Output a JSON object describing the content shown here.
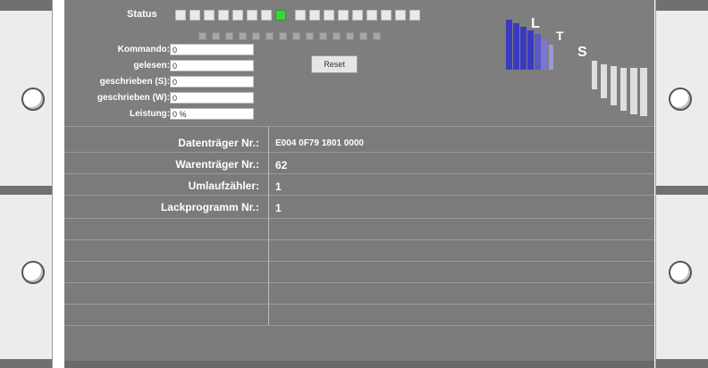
{
  "status": {
    "label": "Status",
    "leds": [
      false,
      false,
      false,
      false,
      false,
      false,
      false,
      true,
      false,
      false,
      false,
      false,
      false,
      false,
      false,
      false,
      false
    ]
  },
  "fields": [
    {
      "label": "Kommando:",
      "value": "0"
    },
    {
      "label": "gelesen:",
      "value": "0"
    },
    {
      "label": "geschrieben (S):",
      "value": "0"
    },
    {
      "label": "geschrieben (W):",
      "value": "0"
    },
    {
      "label": "Leistung:",
      "value": "0 %"
    }
  ],
  "reset_button": "Reset",
  "meter": {
    "letter_l": "L",
    "letter_t": "T",
    "letter_s": "S",
    "accent": "#3a3ac0"
  },
  "rows": [
    {
      "label": "Datenträger Nr.:",
      "value": "E004 0F79 1801 0000"
    },
    {
      "label": "Warenträger Nr.:",
      "value": "62"
    },
    {
      "label": "Umlaufzähler:",
      "value": "1"
    },
    {
      "label": "Lackprogramm Nr.:",
      "value": "1"
    }
  ]
}
